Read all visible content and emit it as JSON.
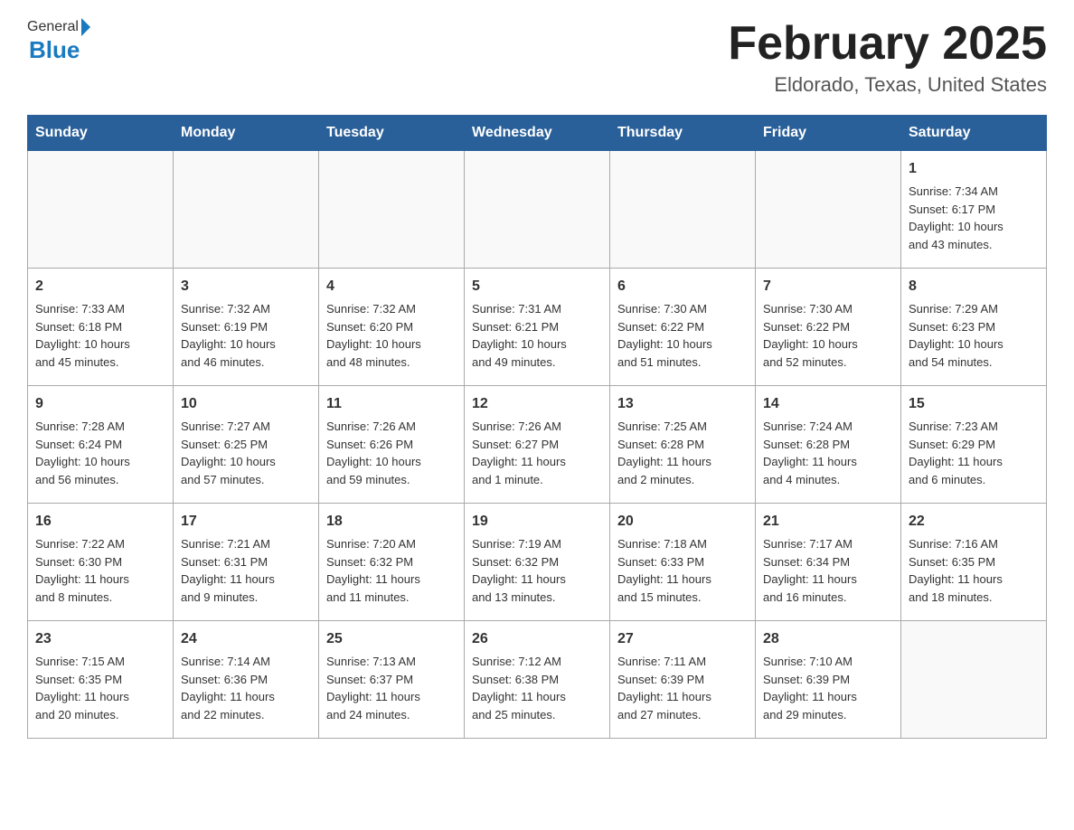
{
  "header": {
    "logo_general": "General",
    "logo_blue": "Blue",
    "calendar_title": "February 2025",
    "calendar_subtitle": "Eldorado, Texas, United States"
  },
  "weekdays": [
    "Sunday",
    "Monday",
    "Tuesday",
    "Wednesday",
    "Thursday",
    "Friday",
    "Saturday"
  ],
  "weeks": [
    [
      {
        "day": "",
        "info": ""
      },
      {
        "day": "",
        "info": ""
      },
      {
        "day": "",
        "info": ""
      },
      {
        "day": "",
        "info": ""
      },
      {
        "day": "",
        "info": ""
      },
      {
        "day": "",
        "info": ""
      },
      {
        "day": "1",
        "info": "Sunrise: 7:34 AM\nSunset: 6:17 PM\nDaylight: 10 hours\nand 43 minutes."
      }
    ],
    [
      {
        "day": "2",
        "info": "Sunrise: 7:33 AM\nSunset: 6:18 PM\nDaylight: 10 hours\nand 45 minutes."
      },
      {
        "day": "3",
        "info": "Sunrise: 7:32 AM\nSunset: 6:19 PM\nDaylight: 10 hours\nand 46 minutes."
      },
      {
        "day": "4",
        "info": "Sunrise: 7:32 AM\nSunset: 6:20 PM\nDaylight: 10 hours\nand 48 minutes."
      },
      {
        "day": "5",
        "info": "Sunrise: 7:31 AM\nSunset: 6:21 PM\nDaylight: 10 hours\nand 49 minutes."
      },
      {
        "day": "6",
        "info": "Sunrise: 7:30 AM\nSunset: 6:22 PM\nDaylight: 10 hours\nand 51 minutes."
      },
      {
        "day": "7",
        "info": "Sunrise: 7:30 AM\nSunset: 6:22 PM\nDaylight: 10 hours\nand 52 minutes."
      },
      {
        "day": "8",
        "info": "Sunrise: 7:29 AM\nSunset: 6:23 PM\nDaylight: 10 hours\nand 54 minutes."
      }
    ],
    [
      {
        "day": "9",
        "info": "Sunrise: 7:28 AM\nSunset: 6:24 PM\nDaylight: 10 hours\nand 56 minutes."
      },
      {
        "day": "10",
        "info": "Sunrise: 7:27 AM\nSunset: 6:25 PM\nDaylight: 10 hours\nand 57 minutes."
      },
      {
        "day": "11",
        "info": "Sunrise: 7:26 AM\nSunset: 6:26 PM\nDaylight: 10 hours\nand 59 minutes."
      },
      {
        "day": "12",
        "info": "Sunrise: 7:26 AM\nSunset: 6:27 PM\nDaylight: 11 hours\nand 1 minute."
      },
      {
        "day": "13",
        "info": "Sunrise: 7:25 AM\nSunset: 6:28 PM\nDaylight: 11 hours\nand 2 minutes."
      },
      {
        "day": "14",
        "info": "Sunrise: 7:24 AM\nSunset: 6:28 PM\nDaylight: 11 hours\nand 4 minutes."
      },
      {
        "day": "15",
        "info": "Sunrise: 7:23 AM\nSunset: 6:29 PM\nDaylight: 11 hours\nand 6 minutes."
      }
    ],
    [
      {
        "day": "16",
        "info": "Sunrise: 7:22 AM\nSunset: 6:30 PM\nDaylight: 11 hours\nand 8 minutes."
      },
      {
        "day": "17",
        "info": "Sunrise: 7:21 AM\nSunset: 6:31 PM\nDaylight: 11 hours\nand 9 minutes."
      },
      {
        "day": "18",
        "info": "Sunrise: 7:20 AM\nSunset: 6:32 PM\nDaylight: 11 hours\nand 11 minutes."
      },
      {
        "day": "19",
        "info": "Sunrise: 7:19 AM\nSunset: 6:32 PM\nDaylight: 11 hours\nand 13 minutes."
      },
      {
        "day": "20",
        "info": "Sunrise: 7:18 AM\nSunset: 6:33 PM\nDaylight: 11 hours\nand 15 minutes."
      },
      {
        "day": "21",
        "info": "Sunrise: 7:17 AM\nSunset: 6:34 PM\nDaylight: 11 hours\nand 16 minutes."
      },
      {
        "day": "22",
        "info": "Sunrise: 7:16 AM\nSunset: 6:35 PM\nDaylight: 11 hours\nand 18 minutes."
      }
    ],
    [
      {
        "day": "23",
        "info": "Sunrise: 7:15 AM\nSunset: 6:35 PM\nDaylight: 11 hours\nand 20 minutes."
      },
      {
        "day": "24",
        "info": "Sunrise: 7:14 AM\nSunset: 6:36 PM\nDaylight: 11 hours\nand 22 minutes."
      },
      {
        "day": "25",
        "info": "Sunrise: 7:13 AM\nSunset: 6:37 PM\nDaylight: 11 hours\nand 24 minutes."
      },
      {
        "day": "26",
        "info": "Sunrise: 7:12 AM\nSunset: 6:38 PM\nDaylight: 11 hours\nand 25 minutes."
      },
      {
        "day": "27",
        "info": "Sunrise: 7:11 AM\nSunset: 6:39 PM\nDaylight: 11 hours\nand 27 minutes."
      },
      {
        "day": "28",
        "info": "Sunrise: 7:10 AM\nSunset: 6:39 PM\nDaylight: 11 hours\nand 29 minutes."
      },
      {
        "day": "",
        "info": ""
      }
    ]
  ]
}
